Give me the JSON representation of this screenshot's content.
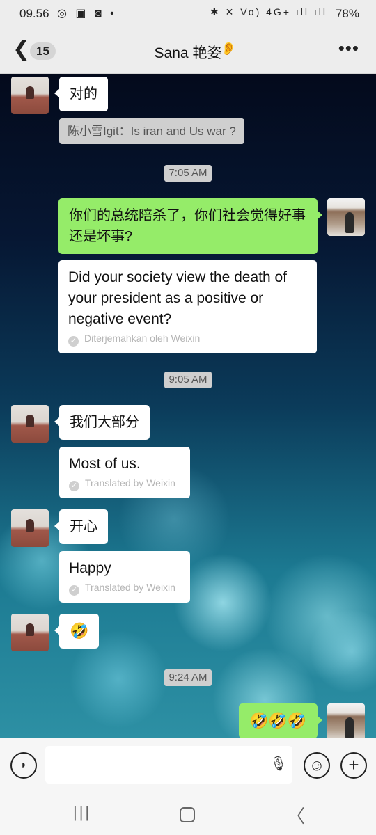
{
  "status_bar": {
    "time": "09.56",
    "left_icons": "◎ ▣ ◙ •",
    "right_icons": "✱ ✕ Vo) 4G+ ıll ıll",
    "battery": "78%"
  },
  "header": {
    "back_glyph": "❮",
    "unread_count": "15",
    "title": "Sana 艳姿",
    "ear_glyph": "👂",
    "more_glyph": "•••"
  },
  "messages": [
    {
      "side": "left",
      "text": "对的"
    },
    {
      "type": "quote",
      "text": "陈小雪Igit：Is iran and Us war ?"
    },
    {
      "type": "time",
      "text": "7:05 AM"
    },
    {
      "side": "right",
      "text": "你们的总统陪杀了，你们社会觉得好事还是坏事?"
    },
    {
      "type": "translation",
      "text": "Did your society view the death of your president as a positive or negative event?",
      "credit": "Diterjemahkan oleh Weixin"
    },
    {
      "type": "time",
      "text": "9:05 AM"
    },
    {
      "side": "left",
      "text": "我们大部分"
    },
    {
      "type": "translation",
      "text": "Most of us.",
      "credit": "Translated by Weixin"
    },
    {
      "side": "left",
      "text": "开心"
    },
    {
      "type": "translation",
      "text": "Happy",
      "credit": "Translated by Weixin"
    },
    {
      "side": "left",
      "text": "🤣"
    },
    {
      "type": "time",
      "text": "9:24 AM"
    },
    {
      "side": "right",
      "text": "🤣🤣🤣"
    }
  ],
  "input_bar": {
    "voice_glyph": "◗",
    "placeholder": "",
    "mic_glyph": "🎙",
    "emoji_glyph": "☺",
    "plus_glyph": "+"
  },
  "nav_bar": {
    "recent_glyph": "|||",
    "back_glyph": "〈"
  },
  "icons": {
    "check_glyph": "✓"
  },
  "colors": {
    "green_bubble": "#95ec69",
    "bar_bg": "#ededed"
  }
}
